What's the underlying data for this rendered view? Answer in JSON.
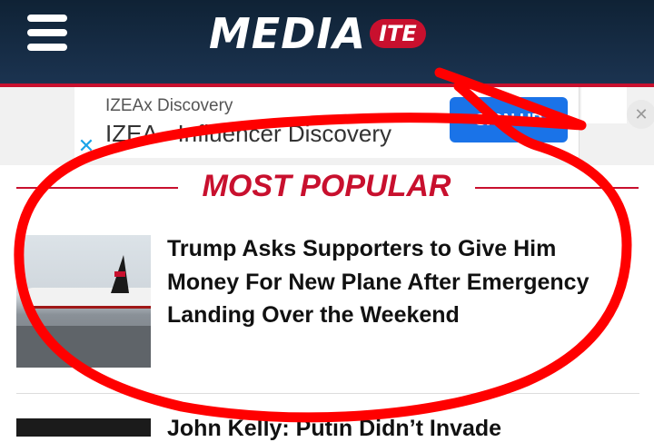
{
  "header": {
    "logo_main": "MEDIA",
    "logo_badge": "ITE"
  },
  "ad": {
    "sponsor": "IZEAx Discovery",
    "title": "IZEA - Influencer Discovery",
    "cta": "SIGN UP",
    "info_icon": "adchoices-icon",
    "close_icon": "close-icon"
  },
  "section": {
    "title": "MOST POPULAR"
  },
  "articles": [
    {
      "headline": "Trump Asks Supporters to Give Him Money For New Plane After Emergency Landing Over the Weekend"
    },
    {
      "headline": "John Kelly: Putin Didn’t Invade"
    }
  ],
  "colors": {
    "header_bg": "#132a42",
    "accent_red": "#c8102e",
    "cta_blue": "#1a73e8",
    "annotation_red": "#ff0000"
  }
}
